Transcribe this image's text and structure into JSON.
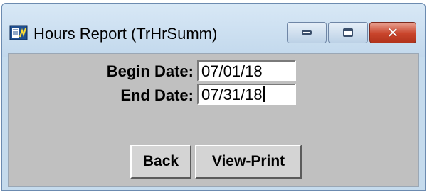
{
  "window": {
    "title": "Hours Report (TrHrSumm)",
    "icon": "report-app-icon",
    "controls": [
      "minimize-icon",
      "maximize-icon",
      "close-icon"
    ]
  },
  "form": {
    "begin_label": "Begin Date:",
    "begin_value": "07/01/18",
    "end_label": "End Date:",
    "end_value": "07/31/18"
  },
  "buttons": {
    "back": "Back",
    "view_print": "View-Print"
  },
  "colors": {
    "client_bg": "#c0c0c0",
    "titlebar": "#c5dbed",
    "close_button": "#c9452c"
  }
}
